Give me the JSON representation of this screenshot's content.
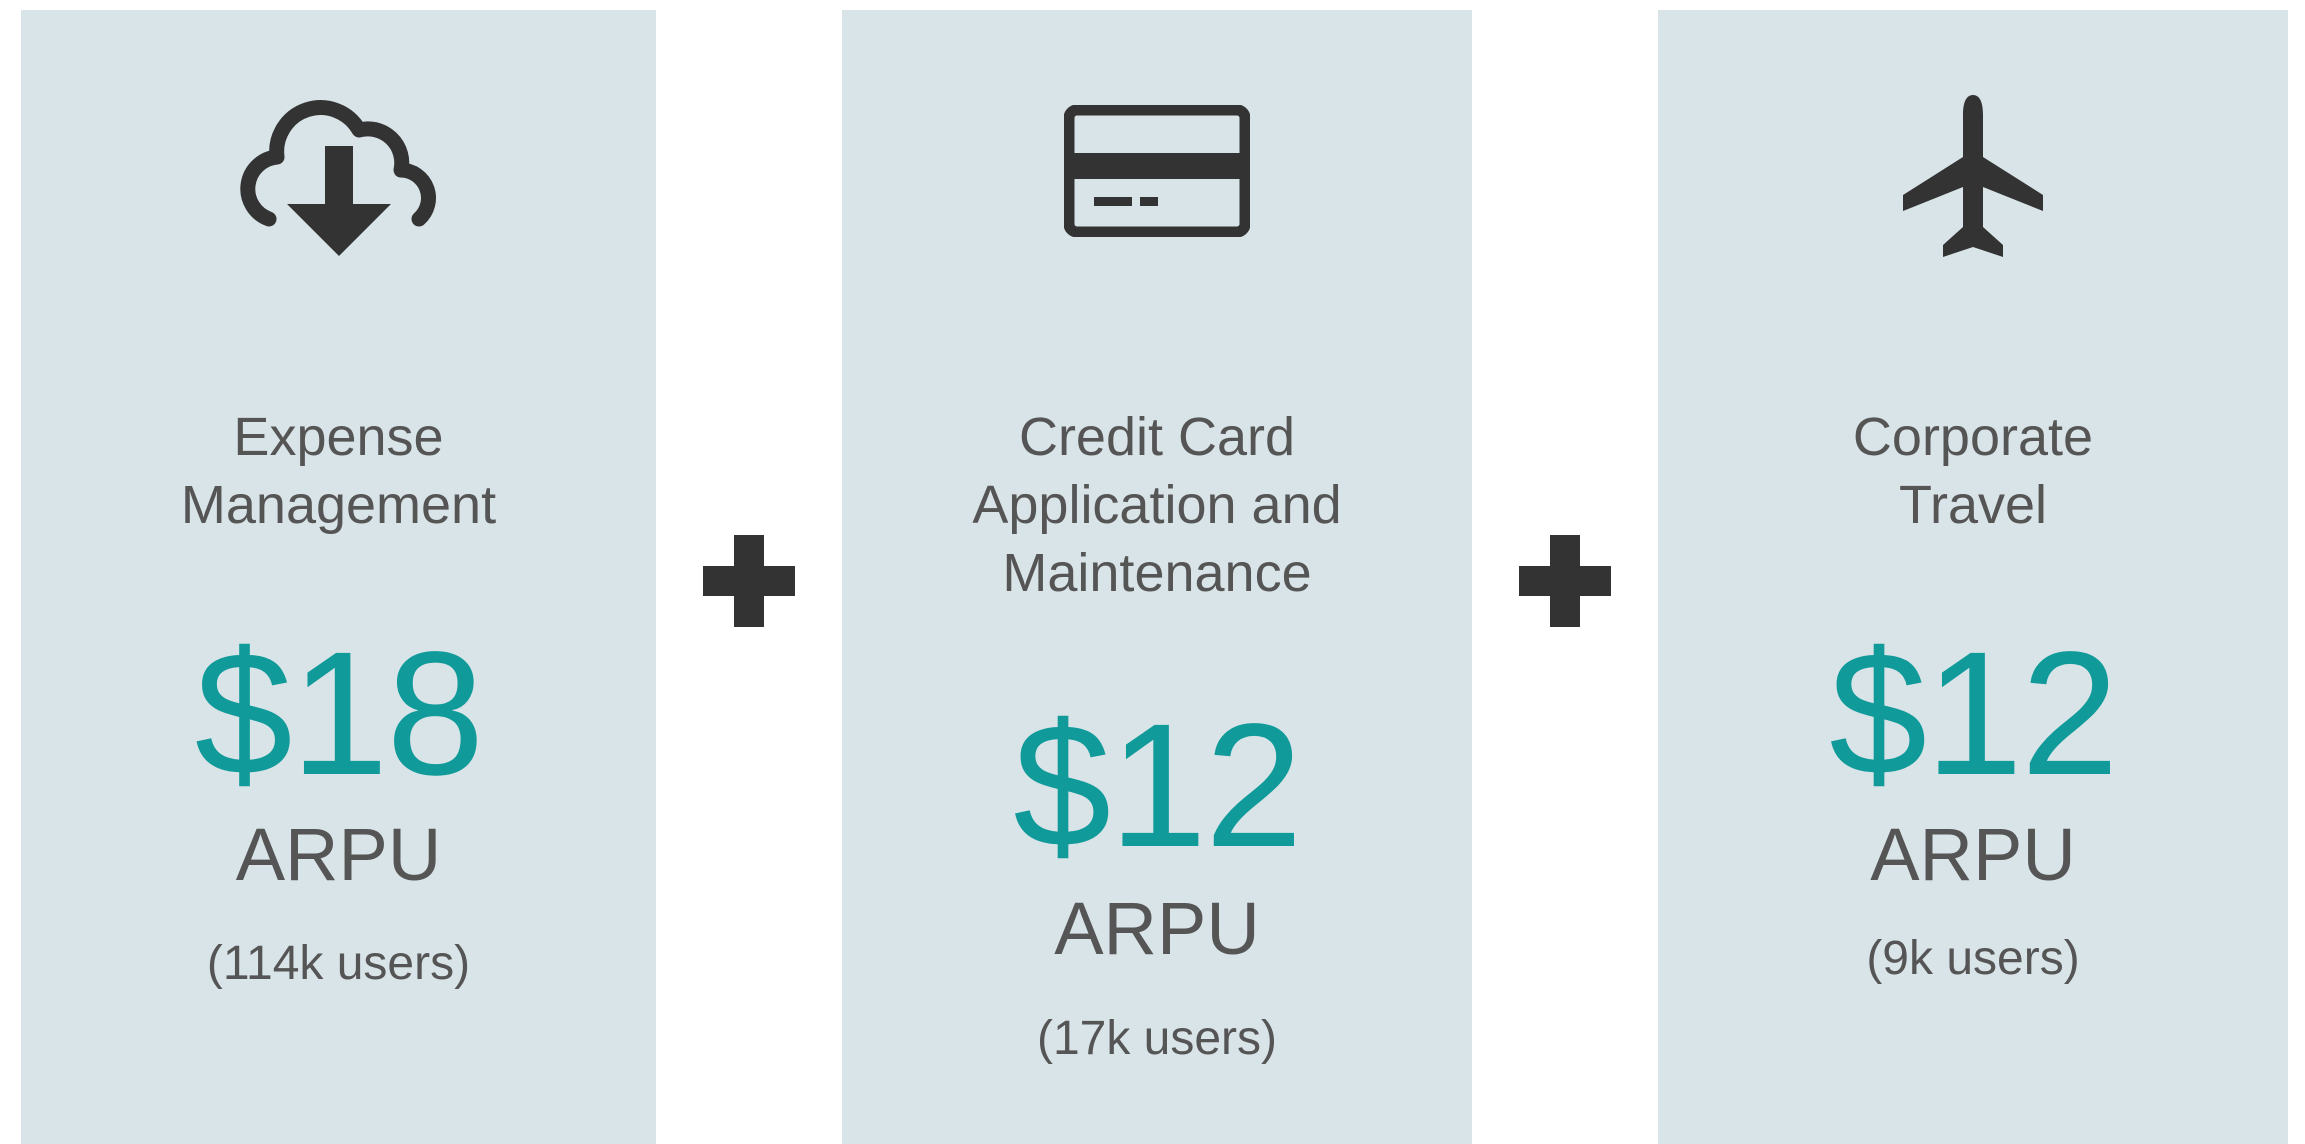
{
  "colors": {
    "card_background": "#d9e4e8",
    "accent_price": "#109a9a",
    "text": "#555555",
    "icon": "#333333"
  },
  "operator_icon": "plus-icon",
  "cards": [
    {
      "icon": "cloud-download-icon",
      "title_lines": [
        "Expense",
        "Management"
      ],
      "price": "$18",
      "metric": "ARPU",
      "users": "(114k users)"
    },
    {
      "icon": "credit-card-icon",
      "title_lines": [
        "Credit Card",
        "Application and",
        "Maintenance"
      ],
      "price": "$12",
      "metric": "ARPU",
      "users": "(17k users)"
    },
    {
      "icon": "airplane-icon",
      "title_lines": [
        "Corporate",
        "Travel"
      ],
      "price": "$12",
      "metric": "ARPU",
      "users": "(9k users)"
    }
  ]
}
